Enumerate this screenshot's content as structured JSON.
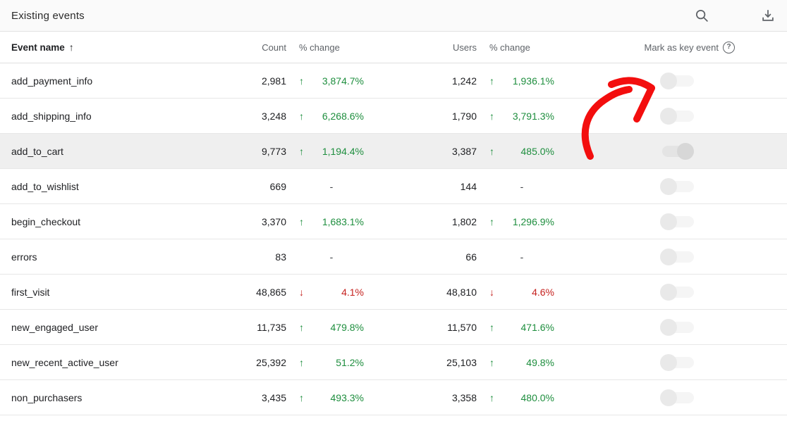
{
  "title_bar": {
    "title": "Existing events",
    "search_icon": "magnifier",
    "download_icon": "download-tray"
  },
  "icons": {
    "up_arrow": "↑",
    "down_arrow": "↓",
    "sort_arrow": "↑",
    "help": "?"
  },
  "colors": {
    "positive": "#1e8e3e",
    "negative": "#c5221f",
    "annotation_red": "#f30e0e",
    "highlight_row_bg": "#efefef",
    "titlebar_bg": "#fafafa"
  },
  "table": {
    "headers": {
      "event_name": "Event name",
      "count": "Count",
      "pct_change_count": "% change",
      "users": "Users",
      "pct_change_users": "% change",
      "key_event": "Mark as key event"
    },
    "rows": [
      {
        "name": "add_payment_info",
        "count": "2,981",
        "count_change": {
          "dir": "up",
          "value": "3,874.7%"
        },
        "users": "1,242",
        "users_change": {
          "dir": "up",
          "value": "1,936.1%"
        },
        "toggle": "off",
        "highlight": false
      },
      {
        "name": "add_shipping_info",
        "count": "3,248",
        "count_change": {
          "dir": "up",
          "value": "6,268.6%"
        },
        "users": "1,790",
        "users_change": {
          "dir": "up",
          "value": "3,791.3%"
        },
        "toggle": "off",
        "highlight": false
      },
      {
        "name": "add_to_cart",
        "count": "9,773",
        "count_change": {
          "dir": "up",
          "value": "1,194.4%"
        },
        "users": "3,387",
        "users_change": {
          "dir": "up",
          "value": "485.0%"
        },
        "toggle": "off-right",
        "highlight": true
      },
      {
        "name": "add_to_wishlist",
        "count": "669",
        "count_change": {
          "dir": "none",
          "value": "-"
        },
        "users": "144",
        "users_change": {
          "dir": "none",
          "value": "-"
        },
        "toggle": "off",
        "highlight": false
      },
      {
        "name": "begin_checkout",
        "count": "3,370",
        "count_change": {
          "dir": "up",
          "value": "1,683.1%"
        },
        "users": "1,802",
        "users_change": {
          "dir": "up",
          "value": "1,296.9%"
        },
        "toggle": "off",
        "highlight": false
      },
      {
        "name": "errors",
        "count": "83",
        "count_change": {
          "dir": "none",
          "value": "-"
        },
        "users": "66",
        "users_change": {
          "dir": "none",
          "value": "-"
        },
        "toggle": "off",
        "highlight": false
      },
      {
        "name": "first_visit",
        "count": "48,865",
        "count_change": {
          "dir": "down",
          "value": "4.1%"
        },
        "users": "48,810",
        "users_change": {
          "dir": "down",
          "value": "4.6%"
        },
        "toggle": "off",
        "highlight": false
      },
      {
        "name": "new_engaged_user",
        "count": "11,735",
        "count_change": {
          "dir": "up",
          "value": "479.8%"
        },
        "users": "11,570",
        "users_change": {
          "dir": "up",
          "value": "471.6%"
        },
        "toggle": "off",
        "highlight": false
      },
      {
        "name": "new_recent_active_user",
        "count": "25,392",
        "count_change": {
          "dir": "up",
          "value": "51.2%"
        },
        "users": "25,103",
        "users_change": {
          "dir": "up",
          "value": "49.8%"
        },
        "toggle": "off",
        "highlight": false
      },
      {
        "name": "non_purchasers",
        "count": "3,435",
        "count_change": {
          "dir": "up",
          "value": "493.3%"
        },
        "users": "3,358",
        "users_change": {
          "dir": "up",
          "value": "480.0%"
        },
        "toggle": "off",
        "highlight": false
      }
    ]
  }
}
